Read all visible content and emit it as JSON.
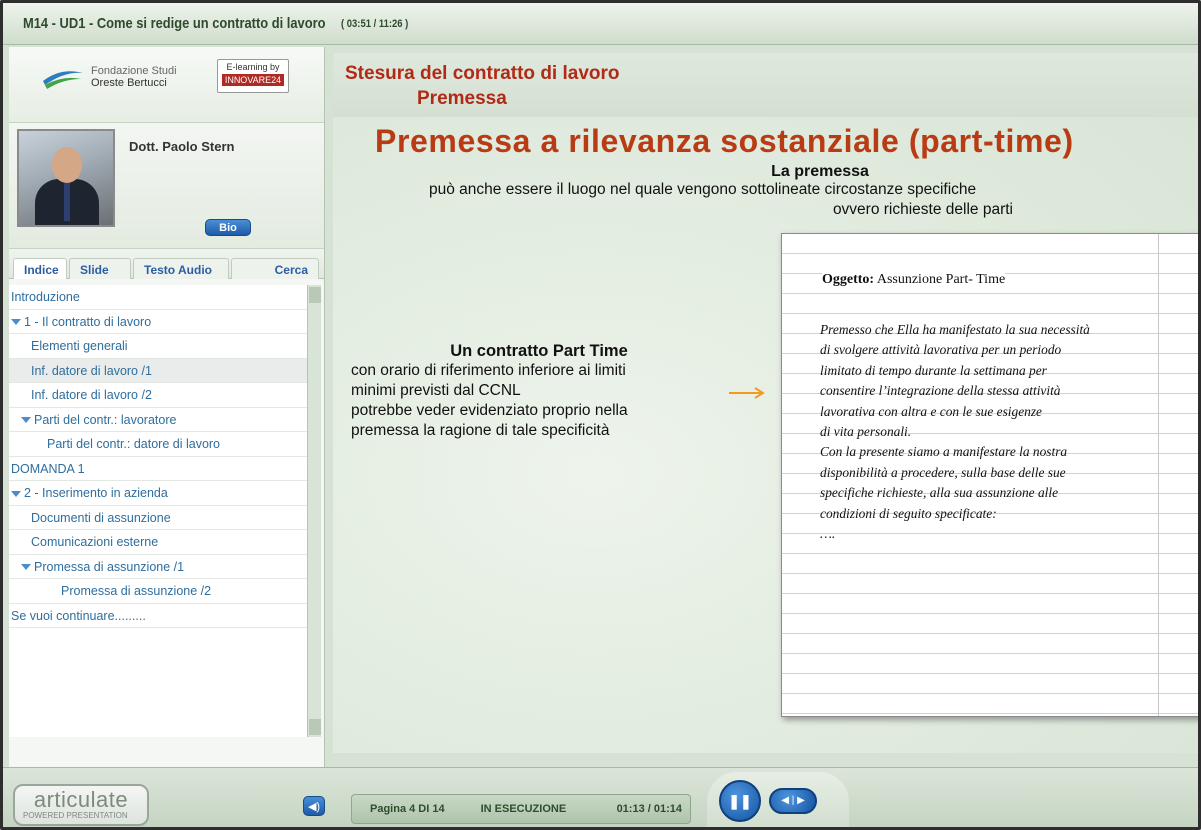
{
  "window": {
    "title": "M14 - UD1 - Come si redige un contratto di lavoro",
    "time": "( 03:51 / 11:26 )"
  },
  "logos": {
    "fondazione_line1": "Fondazione Studi",
    "fondazione_line2": "Oreste Bertucci",
    "elearning_label": "E-learning by",
    "elearning_brand": "INNOVARE24"
  },
  "presenter": {
    "name": "Dott. Paolo Stern",
    "bio_label": "Bio"
  },
  "tabs": [
    {
      "label": "Indice",
      "active": true
    },
    {
      "label": "Slide",
      "active": false
    },
    {
      "label": "Testo Audio",
      "active": false
    },
    {
      "label": "Cerca",
      "active": false
    }
  ],
  "toc": [
    {
      "label": "Introduzione",
      "level": 0,
      "expanded": false,
      "selected": false
    },
    {
      "label": "1 - Il contratto di lavoro",
      "level": 0,
      "expanded": true,
      "selected": false
    },
    {
      "label": "Elementi generali",
      "level": 1,
      "expanded": false,
      "selected": false
    },
    {
      "label": "Inf. datore di lavoro /1",
      "level": 1,
      "expanded": false,
      "selected": true
    },
    {
      "label": "Inf. datore di lavoro /2",
      "level": 1,
      "expanded": false,
      "selected": false
    },
    {
      "label": "Parti del contr.: lavoratore",
      "level": 1,
      "expanded": true,
      "selected": false
    },
    {
      "label": "Parti del contr.: datore di lavoro",
      "level": 2,
      "expanded": false,
      "selected": false
    },
    {
      "label": "DOMANDA 1",
      "level": 0,
      "expanded": false,
      "selected": false
    },
    {
      "label": "2 - Inserimento in azienda",
      "level": 0,
      "expanded": true,
      "selected": false
    },
    {
      "label": "Documenti di assunzione",
      "level": 1,
      "expanded": false,
      "selected": false
    },
    {
      "label": "Comunicazioni esterne",
      "level": 1,
      "expanded": false,
      "selected": false
    },
    {
      "label": "Promessa di assunzione /1",
      "level": 1,
      "expanded": true,
      "selected": false
    },
    {
      "label": "Promessa di assunzione /2",
      "level": 2,
      "expanded": false,
      "selected": false
    },
    {
      "label": "Se vuoi continuare.........",
      "level": 0,
      "expanded": false,
      "selected": false
    }
  ],
  "slide": {
    "header_line1": "Stesura del contratto di lavoro",
    "header_line2": "Premessa",
    "title": "Premessa a rilevanza sostanziale (part-time)",
    "subtitle_heading": "La premessa",
    "subtitle_line1": "può anche essere il luogo nel quale vengono sottolineate circostanze specifiche",
    "subtitle_line2": "ovvero richieste delle parti",
    "left_title": "Un contratto Part Time",
    "left_lines": [
      "con orario di riferimento inferiore ai limiti",
      "minimi previsti dal CCNL",
      "potrebbe veder evidenziato proprio nella",
      "premessa la ragione di tale specificità"
    ],
    "letter": {
      "subject_label": "Oggetto:",
      "subject_value": "Assunzione Part- Time",
      "body_lines": [
        "Premesso che Ella ha manifestato la sua necessità",
        "di svolgere attività lavorativa per un periodo",
        " limitato di tempo durante la settimana per",
        "consentire l’integrazione della stessa attività",
        "lavorativa  con altra e con le sue esigenze",
        "di vita personali.",
        "Con la presente siamo a manifestare la nostra",
        "disponibilità a procedere, sulla base delle sue",
        "specifiche richieste, alla sua assunzione alle",
        "condizioni di seguito specificate:",
        "…."
      ]
    }
  },
  "player": {
    "brand": "articulate",
    "brand_sub": "POWERED PRESENTATION",
    "volume_icon": "speaker-icon",
    "page": "Pagina 4 DI 14",
    "state": "IN ESECUZIONE",
    "time": "01:13 / 01:14",
    "pause_icon": "pause-icon",
    "skip_icon": "prev-next-icon"
  },
  "colors": {
    "accent_red": "#b02a16",
    "link_blue": "#2e6e9e",
    "button_blue": "#1d5aa8",
    "arrow_orange": "#f29a1f"
  }
}
